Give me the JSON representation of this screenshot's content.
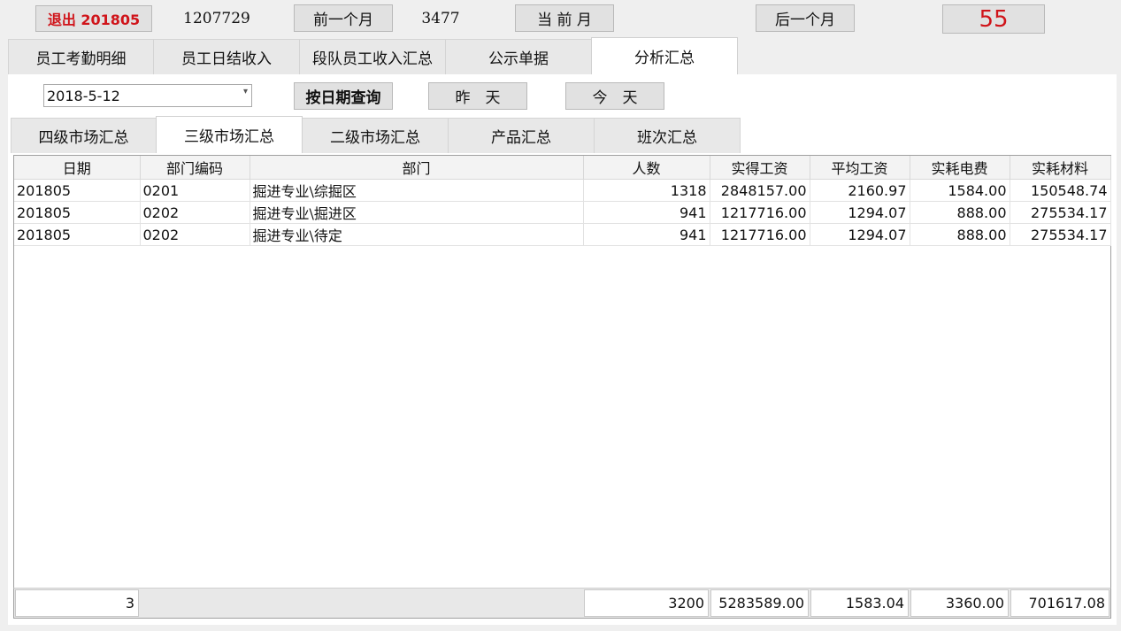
{
  "toolbar": {
    "exit_label": "退出 201805",
    "code": "1207729",
    "prev_month_label": "前一个月",
    "count": "3477",
    "current_month_label": "当 前 月",
    "next_month_label": "后一个月",
    "badge_value": "55"
  },
  "main_tabs": [
    "员工考勤明细",
    "员工日结收入",
    "段队员工收入汇总",
    "公示单据",
    "分析汇总"
  ],
  "main_tabs_active": 4,
  "query": {
    "date_value": "2018-5-12",
    "query_by_date_label": "按日期查询",
    "yesterday_label": "昨　天",
    "today_label": "今　天"
  },
  "sub_tabs": [
    "四级市场汇总",
    "三级市场汇总",
    "二级市场汇总",
    "产品汇总",
    "班次汇总"
  ],
  "sub_tabs_active": 1,
  "table": {
    "headers": [
      "日期",
      "部门编码",
      "部门",
      "人数",
      "实得工资",
      "平均工资",
      "实耗电费",
      "实耗材料"
    ],
    "rows": [
      [
        "201805",
        "0201",
        "掘进专业\\综掘区",
        "1318",
        "2848157.00",
        "2160.97",
        "1584.00",
        "150548.74"
      ],
      [
        "201805",
        "0202",
        "掘进专业\\掘进区",
        "941",
        "1217716.00",
        "1294.07",
        "888.00",
        "275534.17"
      ],
      [
        "201805",
        "0202",
        "掘进专业\\待定",
        "941",
        "1217716.00",
        "1294.07",
        "888.00",
        "275534.17"
      ]
    ]
  },
  "footer": {
    "row_count": "3",
    "people": "3200",
    "salary": "5283589.00",
    "avg_salary": "1583.04",
    "power": "3360.00",
    "material": "701617.08"
  },
  "colors": {
    "accent_red": "#d0141a",
    "background": "#efefef",
    "button": "#e1e1e1"
  }
}
